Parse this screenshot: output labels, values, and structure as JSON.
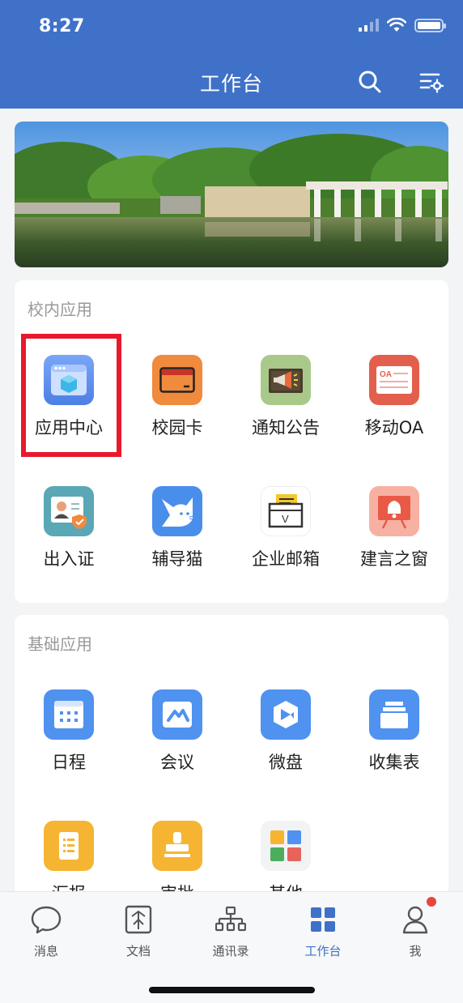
{
  "status_bar": {
    "time": "8:27"
  },
  "header": {
    "title": "工作台",
    "search_icon": "search-icon",
    "settings_icon": "list-settings-icon"
  },
  "banner": {
    "image": "campus-lake-banner"
  },
  "campus_apps": {
    "section_title": "校内应用",
    "items": [
      {
        "label": "应用中心",
        "icon": "app-center-icon",
        "color": "#5b8def"
      },
      {
        "label": "校园卡",
        "icon": "campus-card-icon",
        "color": "#f08a3c"
      },
      {
        "label": "通知公告",
        "icon": "announcement-icon",
        "color": "#a8c98a"
      },
      {
        "label": "移动OA",
        "icon": "mobile-oa-icon",
        "color": "#e35f4d"
      },
      {
        "label": "出入证",
        "icon": "access-pass-icon",
        "color": "#5aa7b5"
      },
      {
        "label": "辅导猫",
        "icon": "tutor-cat-icon",
        "color": "#4a8eeb"
      },
      {
        "label": "企业邮箱",
        "icon": "mailbox-icon",
        "color": "#ffffff"
      },
      {
        "label": "建言之窗",
        "icon": "suggestion-icon",
        "color": "#f7b1a3"
      }
    ]
  },
  "basic_apps": {
    "section_title": "基础应用",
    "items": [
      {
        "label": "日程",
        "icon": "calendar-icon",
        "color": "#4f92f0"
      },
      {
        "label": "会议",
        "icon": "meeting-icon",
        "color": "#4f92f0"
      },
      {
        "label": "微盘",
        "icon": "cloud-disk-icon",
        "color": "#4f92f0"
      },
      {
        "label": "收集表",
        "icon": "form-collect-icon",
        "color": "#4f92f0"
      },
      {
        "label": "汇报",
        "icon": "report-icon",
        "color": "#f5b533"
      },
      {
        "label": "审批",
        "icon": "approval-icon",
        "color": "#f5b533"
      },
      {
        "label": "其他",
        "icon": "others-grid-icon",
        "color": "#f2f3f5"
      }
    ]
  },
  "tabbar": {
    "items": [
      {
        "label": "消息",
        "icon": "chat-bubble-icon",
        "active": false
      },
      {
        "label": "文档",
        "icon": "document-icon",
        "active": false
      },
      {
        "label": "通讯录",
        "icon": "org-chart-icon",
        "active": false
      },
      {
        "label": "工作台",
        "icon": "workbench-grid-icon",
        "active": true
      },
      {
        "label": "我",
        "icon": "person-icon",
        "active": false,
        "badge": true
      }
    ]
  },
  "colors": {
    "brand": "#3f71c8",
    "highlight": "#e8192c",
    "badge": "#e8453c"
  }
}
